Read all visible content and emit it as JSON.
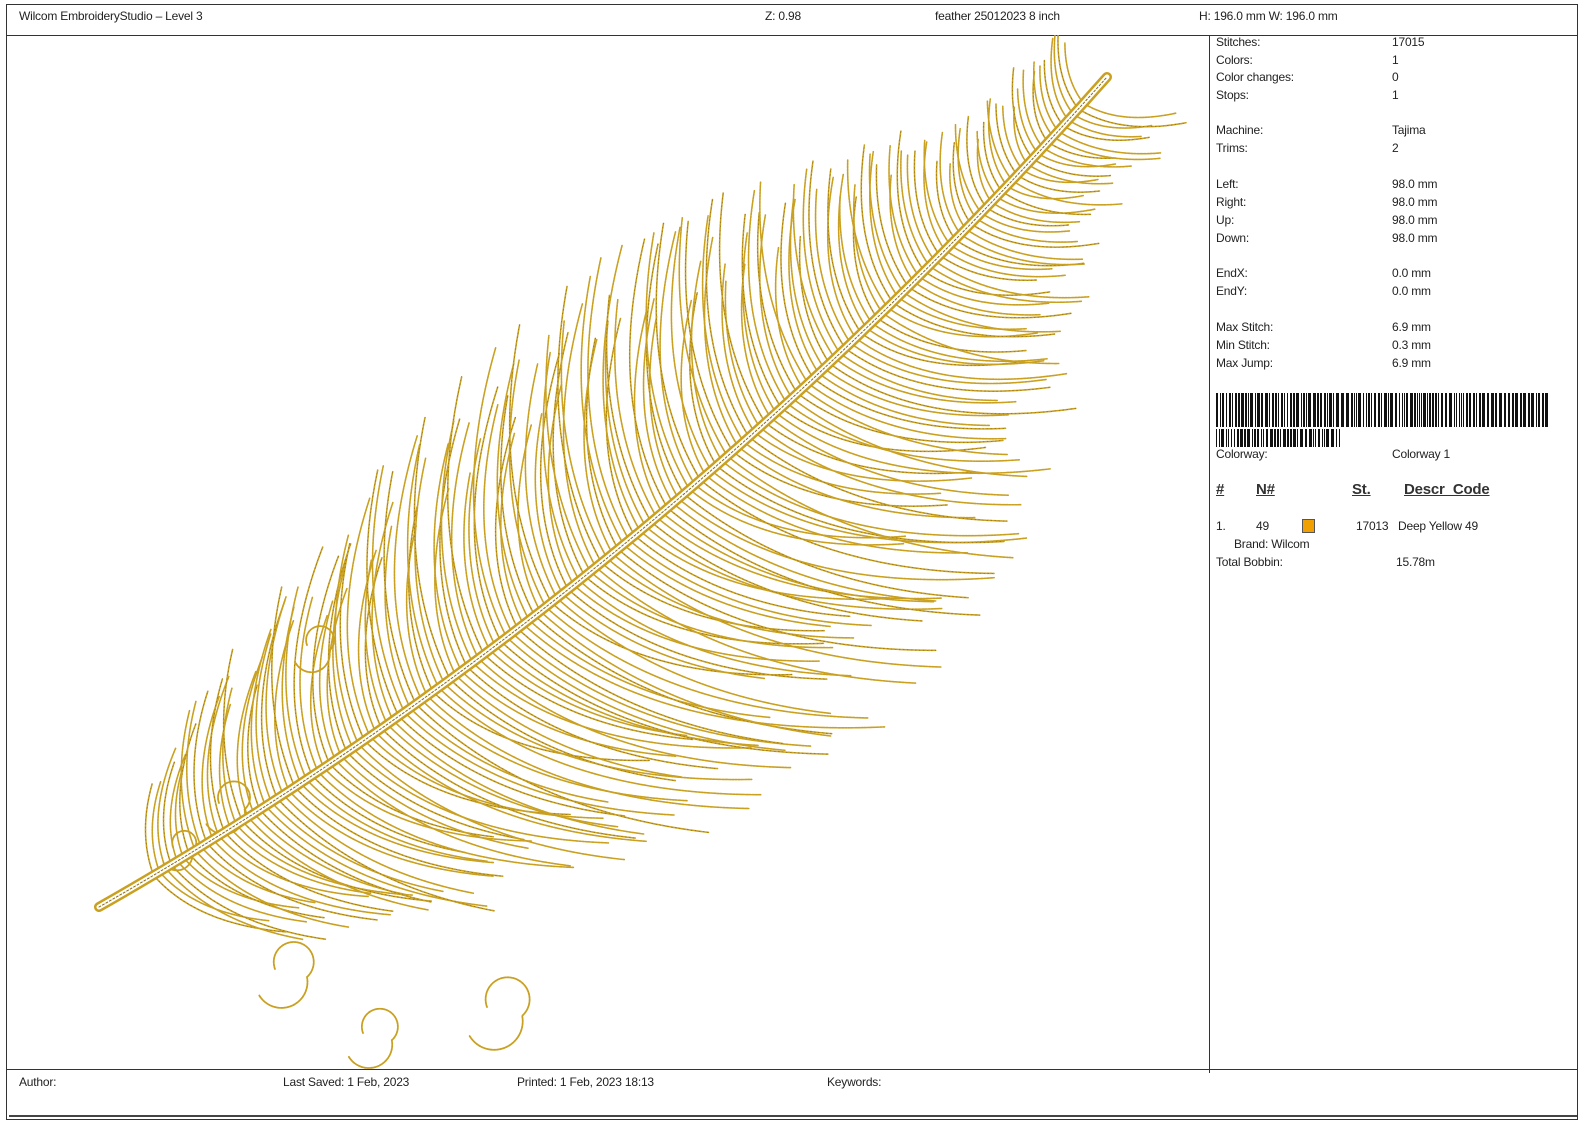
{
  "header": {
    "app_title": "Wilcom EmbroideryStudio – Level 3",
    "zoom": "Z: 0.98",
    "design_name": "feather 25012023 8 inch",
    "dimensions": "H: 196.0 mm   W: 196.0 mm"
  },
  "stats": [
    {
      "label": "Stitches:",
      "value": "17015"
    },
    {
      "label": "Colors:",
      "value": "1"
    },
    {
      "label": "Color changes:",
      "value": "0"
    },
    {
      "label": "Stops:",
      "value": "1"
    },
    {
      "label": "Machine:",
      "value": "Tajima"
    },
    {
      "label": "Trims:",
      "value": "2"
    },
    {
      "label": "Left:",
      "value": "98.0 mm"
    },
    {
      "label": "Right:",
      "value": "98.0 mm"
    },
    {
      "label": "Up:",
      "value": "98.0 mm"
    },
    {
      "label": "Down:",
      "value": "98.0 mm"
    },
    {
      "label": "EndX:",
      "value": "0.0 mm"
    },
    {
      "label": "EndY:",
      "value": "0.0 mm"
    },
    {
      "label": "Max Stitch:",
      "value": "6.9 mm"
    },
    {
      "label": "Min Stitch:",
      "value": "0.3 mm"
    },
    {
      "label": "Max Jump:",
      "value": "6.9 mm"
    }
  ],
  "colorway": {
    "label": "Colorway:",
    "value": "Colorway 1"
  },
  "thread_table": {
    "headers": {
      "num": "#",
      "n": "N#",
      "st": "St.",
      "descr": "Descr_Code"
    },
    "rows": [
      {
        "index": "1.",
        "n": "49",
        "swatch_color": "#f0a000",
        "stitches": "17013",
        "description": "Deep Yellow 49",
        "brand": "Brand: Wilcom"
      }
    ]
  },
  "bobbin": {
    "label": "Total Bobbin:",
    "value": "15.78m"
  },
  "footer": {
    "author": "Author:",
    "last_saved": "Last Saved:  1 Feb, 2023",
    "printed": "Printed:  1 Feb, 2023 18:13",
    "keywords": "Keywords:"
  },
  "design": {
    "thread_color": "#c9a020",
    "shadow_color": "#8a6a10"
  }
}
